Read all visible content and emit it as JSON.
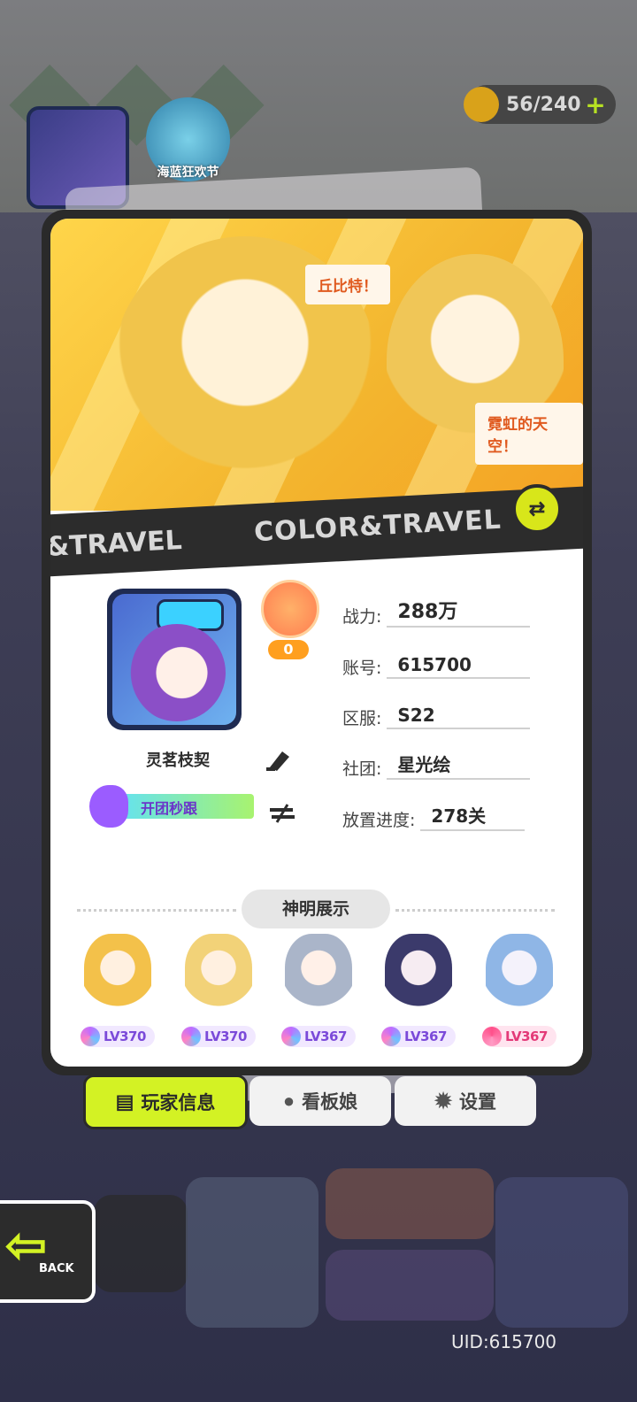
{
  "top": {
    "festival_label": "海蓝狂欢节",
    "energy_text": "56/240"
  },
  "banner": {
    "speech_1": "丘比特！",
    "speech_2": "霓虹的天空！",
    "strip_text": "COLOR&TRAVEL",
    "strip_text_left": "&TRAVEL"
  },
  "profile": {
    "name": "灵茗枝契",
    "rank_value": "0",
    "tag_label": "开团秒跟",
    "fields": [
      {
        "label": "战力:",
        "value": "288万"
      },
      {
        "label": "账号:",
        "value": "615700"
      },
      {
        "label": "区服:",
        "value": "S22"
      },
      {
        "label": "社团:",
        "value": "星光绘"
      },
      {
        "label": "放置进度:",
        "value": "278关"
      }
    ]
  },
  "deity_section": {
    "title": "神明展示",
    "items": [
      {
        "level": "LV370",
        "color": "#f3c14a"
      },
      {
        "level": "LV370",
        "color": "#f2d278"
      },
      {
        "level": "LV367",
        "color": "#aab5c9"
      },
      {
        "level": "LV367",
        "color": "#3b3a6b"
      },
      {
        "level": "LV367",
        "color": "#8fb6e6"
      }
    ]
  },
  "tabs": {
    "player_info": "玩家信息",
    "mascot": "看板娘",
    "settings": "设置"
  },
  "bottom": {
    "back_label": "BACK",
    "uid": "UID:615700"
  },
  "colors": {
    "accent_green": "#d3f224",
    "card_border": "#2a2a2a"
  }
}
